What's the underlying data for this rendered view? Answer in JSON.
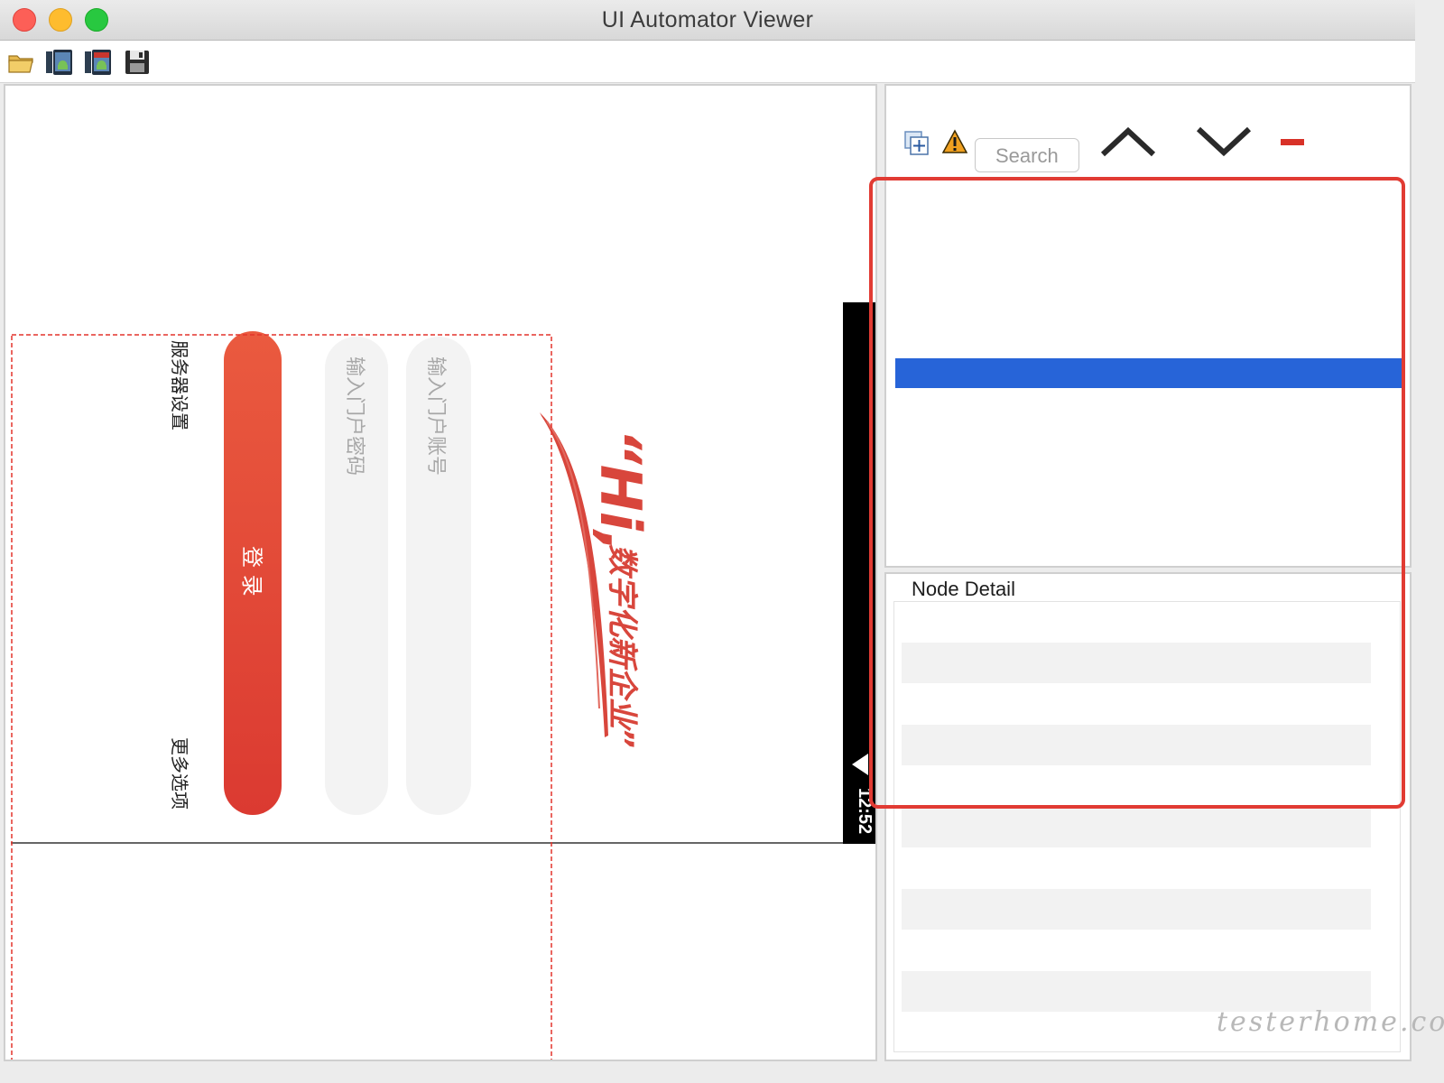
{
  "window": {
    "title": "UI Automator Viewer"
  },
  "toolbar": {
    "tools": [
      "open-folder-icon",
      "device-screenshot-icon",
      "device-screenshot-compressed-icon",
      "save-icon"
    ]
  },
  "device": {
    "status_time": "12:52",
    "app": {
      "server_settings": "服务器设置",
      "more_options": "更多选项",
      "login_button": "登 录",
      "password_placeholder": "输入门户密码",
      "account_placeholder": "输入门户账号",
      "slogan_hi": "“Hi,",
      "slogan_text": "数字化新企业”"
    }
  },
  "tree_toolbar": {
    "search_placeholder": "Search",
    "icons": [
      "expand-all-icon",
      "warning-icon",
      "previous-icon",
      "next-icon",
      "clear-icon"
    ]
  },
  "node_detail": {
    "title": "Node Detail"
  },
  "watermark": "testerhome.com",
  "colors": {
    "selection": "#2764d8",
    "highlight": "#e13b33",
    "login": "#e3453a"
  }
}
